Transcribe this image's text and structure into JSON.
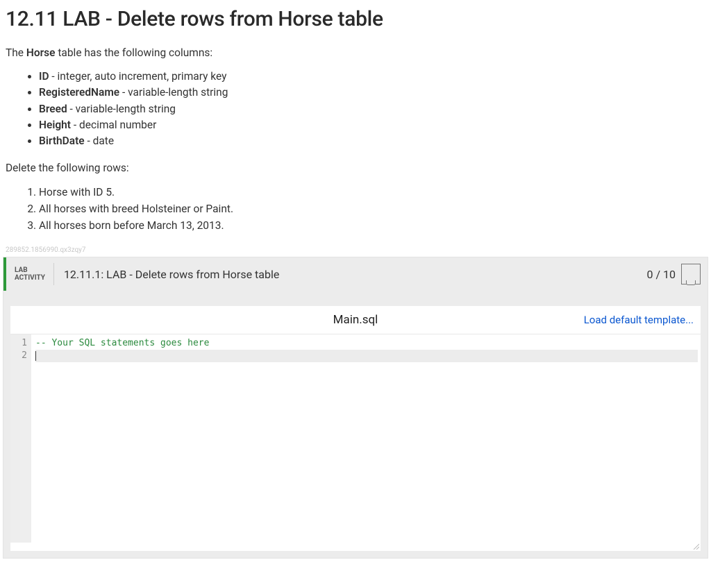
{
  "page_title": "12.11 LAB - Delete rows from Horse table",
  "intro_pre": "The ",
  "intro_bold": "Horse",
  "intro_post": " table has the following columns:",
  "columns": [
    {
      "name": "ID",
      "desc": " - integer, auto increment, primary key"
    },
    {
      "name": "RegisteredName",
      "desc": " - variable-length string"
    },
    {
      "name": "Breed",
      "desc": " - variable-length string"
    },
    {
      "name": "Height",
      "desc": " - decimal number"
    },
    {
      "name": "BirthDate",
      "desc": " - date"
    }
  ],
  "delete_intro": "Delete the following rows:",
  "steps": [
    "Horse with ID 5.",
    "All horses with breed Holsteiner or Paint.",
    "All horses born before March 13, 2013."
  ],
  "tiny_id": "289852.1856990.qx3zqy7",
  "lab": {
    "badge_l1": "LAB",
    "badge_l2": "ACTIVITY",
    "title": "12.11.1: LAB - Delete rows from Horse table",
    "score": "0 / 10"
  },
  "editor": {
    "filename": "Main.sql",
    "load_template": "Load default template...",
    "line1": "-- Your SQL statements goes here",
    "gutter": [
      "1",
      "2"
    ]
  }
}
